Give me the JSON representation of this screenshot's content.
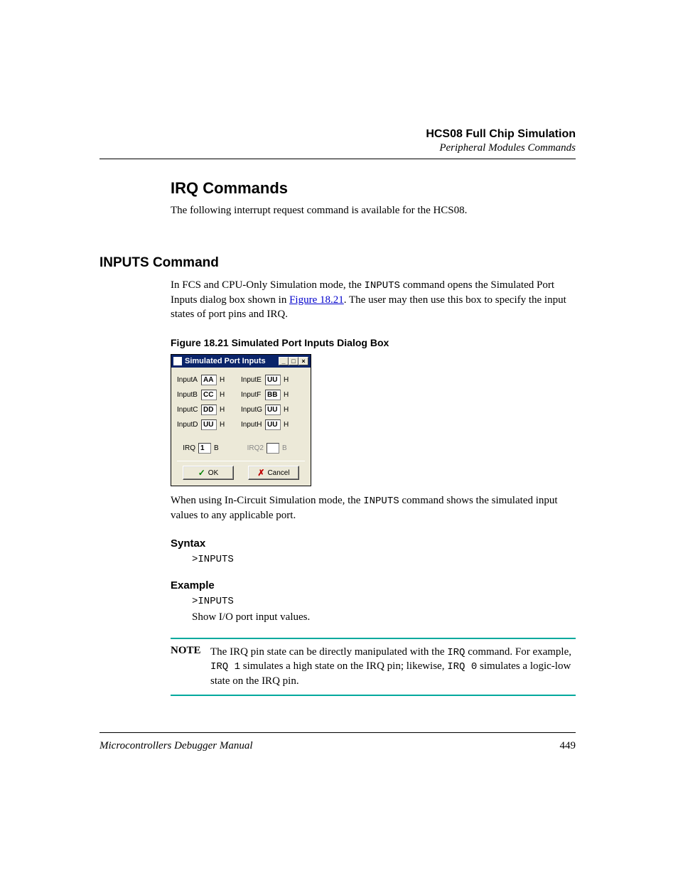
{
  "header": {
    "chapter": "HCS08 Full Chip Simulation",
    "section": "Peripheral Modules Commands"
  },
  "h2": "IRQ Commands",
  "intro": "The following interrupt request command is available for the HCS08.",
  "h3": "INPUTS Command",
  "para1": {
    "pre": "In FCS and CPU-Only Simulation mode, the ",
    "c1": "INPUTS",
    "mid": " command opens the Simulated Port Inputs dialog box shown in ",
    "link": "Figure 18.21",
    "post": ". The user may then use this box to specify the input states of port pins and IRQ."
  },
  "figcap": "Figure 18.21  Simulated Port Inputs Dialog Box",
  "dialog": {
    "title": "Simulated Port Inputs",
    "left": [
      {
        "label": "InputA",
        "val": "AA",
        "suf": "H"
      },
      {
        "label": "InputB",
        "val": "CC",
        "suf": "H"
      },
      {
        "label": "InputC",
        "val": "DD",
        "suf": "H"
      },
      {
        "label": "InputD",
        "val": "UU",
        "suf": "H"
      }
    ],
    "right": [
      {
        "label": "InputE",
        "val": "UU",
        "suf": "H"
      },
      {
        "label": "InputF",
        "val": "BB",
        "suf": "H"
      },
      {
        "label": "InputG",
        "val": "UU",
        "suf": "H"
      },
      {
        "label": "InputH",
        "val": "UU",
        "suf": "H"
      }
    ],
    "irq": {
      "label": "IRQ",
      "val": "1",
      "suf": "B"
    },
    "irq2": {
      "label": "IRQ2",
      "val": "",
      "suf": "B"
    },
    "ok": "OK",
    "cancel": "Cancel"
  },
  "para2": {
    "pre": "When using In-Circuit Simulation mode, the ",
    "c1": "INPUTS",
    "post": " command shows the simulated input values to any applicable port."
  },
  "syntax": {
    "h": "Syntax",
    "code": ">INPUTS"
  },
  "example": {
    "h": "Example",
    "code": ">INPUTS",
    "desc": "Show I/O port input values."
  },
  "note": {
    "label": "NOTE",
    "t1": "The IRQ pin state can be directly manipulated with the ",
    "c1": "IRQ",
    "t2": " command. For example, ",
    "c2": "IRQ 1",
    "t3": " simulates a high state on the IRQ pin; likewise, ",
    "c3": "IRQ 0",
    "t4": " simulates a logic-low state on the IRQ pin."
  },
  "footer": {
    "left": "Microcontrollers Debugger Manual",
    "right": "449"
  }
}
